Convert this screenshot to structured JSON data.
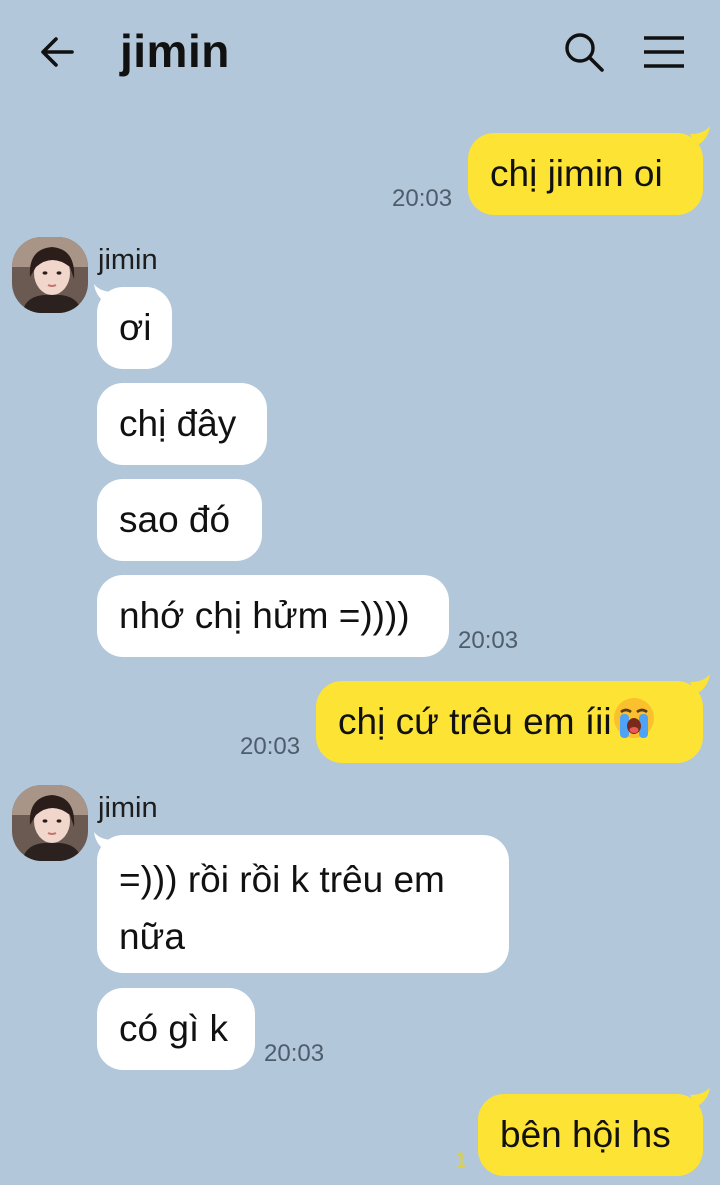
{
  "header": {
    "title": "jimin",
    "back_icon": "arrow-left-icon",
    "search_icon": "search-icon",
    "menu_icon": "menu-icon"
  },
  "colors": {
    "background": "#b2c7da",
    "outgoing_bubble": "#fde333",
    "incoming_bubble": "#ffffff"
  },
  "messages": {
    "m1": {
      "text": "chị jimin oi",
      "time": "20:03"
    },
    "g1": {
      "sender": "jimin",
      "m2": "ơi",
      "m3": "chị đây",
      "m4": "sao đó",
      "m5": "nhớ chị hửm =))))",
      "time": "20:03"
    },
    "m6": {
      "text": "chị cứ trêu em íii",
      "emoji": "loudly-crying-face-emoji",
      "time": "20:03"
    },
    "g2": {
      "sender": "jimin",
      "m7": "=))) rồi rồi k trêu em nữa",
      "m8": "có gì k",
      "time": "20:03"
    },
    "m9": {
      "text": "bên hội hs",
      "unread": "1"
    }
  }
}
